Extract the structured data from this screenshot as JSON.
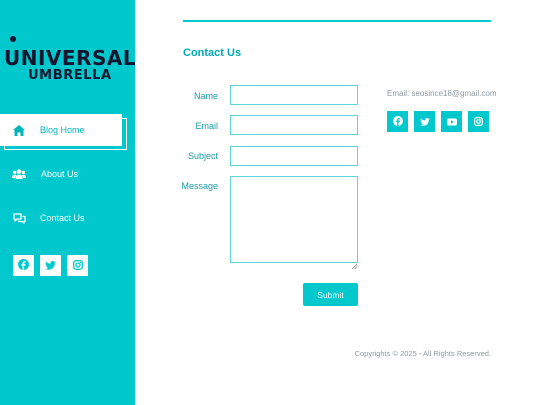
{
  "logo": {
    "line1": "UNIVERSAL",
    "line2": "UMBRELLA"
  },
  "sidebar": {
    "items": [
      {
        "label": "Blog Home",
        "icon": "home-icon"
      },
      {
        "label": "About Us",
        "icon": "users-icon"
      },
      {
        "label": "Contact Us",
        "icon": "chat-icon"
      }
    ],
    "social": [
      "facebook-icon",
      "twitter-icon",
      "instagram-icon"
    ]
  },
  "main": {
    "title": "Contact Us",
    "form": {
      "name_label": "Name",
      "email_label": "Email",
      "subject_label": "Subject",
      "message_label": "Message",
      "name_value": "",
      "email_value": "",
      "subject_value": "",
      "message_value": "",
      "submit_label": "Submit"
    },
    "contact_email": "Email: seosince18@gmail.com",
    "social": [
      "facebook-icon",
      "twitter-icon",
      "youtube-icon",
      "instagram-icon"
    ]
  },
  "footer": {
    "copyright": "Copyrights © 2025 - All Rights Reserved."
  },
  "colors": {
    "accent": "#00c8cc",
    "text_accent": "#1e9aa8",
    "logo_dark": "#151530",
    "muted": "#8f9aa0"
  }
}
